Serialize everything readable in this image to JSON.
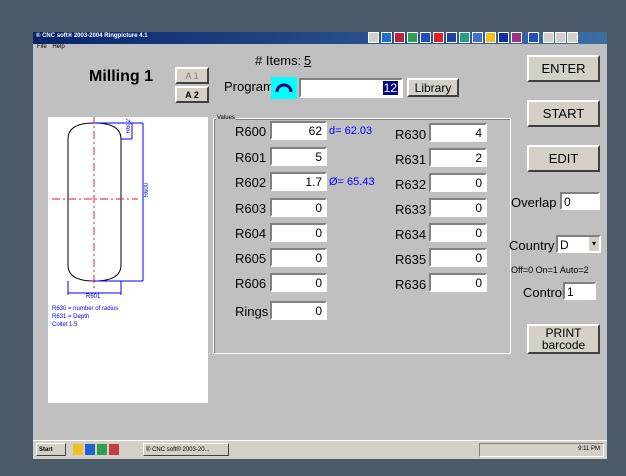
{
  "window": {
    "title": "® CNC soft® 2003-2004 Ringpicture 4.1"
  },
  "menu": [
    "File",
    "Help"
  ],
  "header": {
    "title": "Milling 1",
    "btn_a1": "A 1",
    "btn_a2": "A 2",
    "items_label": "# Items:",
    "items_count": "5",
    "program_label": "Program",
    "program_value": "12",
    "library_label": "Library"
  },
  "values": {
    "group_label": "Values",
    "left": [
      {
        "label": "R600",
        "value": "62",
        "note": "d= 62.03"
      },
      {
        "label": "R601",
        "value": "5",
        "note": ""
      },
      {
        "label": "R602",
        "value": "1.7",
        "note": "Ø= 65.43"
      },
      {
        "label": "R603",
        "value": "0",
        "note": ""
      },
      {
        "label": "R604",
        "value": "0",
        "note": ""
      },
      {
        "label": "R605",
        "value": "0",
        "note": ""
      },
      {
        "label": "R606",
        "value": "0",
        "note": ""
      }
    ],
    "right": [
      {
        "label": "R630",
        "value": "4"
      },
      {
        "label": "R631",
        "value": "2"
      },
      {
        "label": "R632",
        "value": "0"
      },
      {
        "label": "R633",
        "value": "0"
      },
      {
        "label": "R634",
        "value": "0"
      },
      {
        "label": "R635",
        "value": "0"
      },
      {
        "label": "R636",
        "value": "0"
      }
    ],
    "rings_label": "Rings",
    "rings_value": "0"
  },
  "drawing": {
    "dim_top": "R602",
    "dim_side": "R600",
    "dim_bottom": "R601",
    "legend": [
      "R630 = number of radius",
      "R631 = Depth",
      "Collet 1.5"
    ]
  },
  "side": {
    "enter": "ENTER",
    "start": "START",
    "edit": "EDIT",
    "overlap_label": "Overlap",
    "overlap_value": "0",
    "country_label": "Country",
    "country_value": "D",
    "control_hint": "Off=0  On=1 Auto=2",
    "control_label": "Control",
    "control_value": "1",
    "print_line1": "PRINT",
    "print_line2": "barcode"
  },
  "taskbar": {
    "start": "Start",
    "task": "® CNC soft® 2003-20...",
    "clock": "9:11 PM"
  },
  "colors": {
    "accent": "#0000ff",
    "titlebar": "#0a246a",
    "highlight": "#00ffff"
  }
}
